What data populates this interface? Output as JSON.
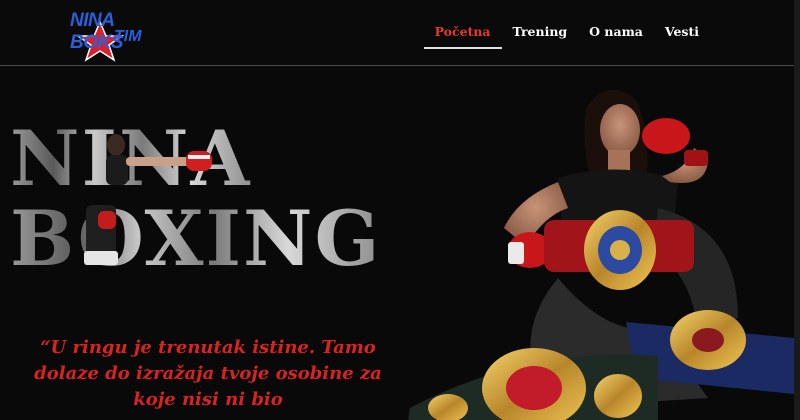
{
  "logo": {
    "line1": "NINA BOKS",
    "line2": "TIM"
  },
  "nav": {
    "items": [
      {
        "label": "Početna",
        "active": true
      },
      {
        "label": "Trening",
        "active": false
      },
      {
        "label": "O nama",
        "active": false
      },
      {
        "label": "Vesti",
        "active": false
      }
    ]
  },
  "hero": {
    "title_line1": "NINA",
    "title_line2": "BOXING",
    "quote": "“U ringu je trenutak istine. Tamo dolaze do izražaja tvoje osobine za koje nisi ni bio"
  },
  "colors": {
    "accent_red": "#e23b2b",
    "quote_red": "#d9231f",
    "logo_blue": "#2b5fd9",
    "background": "#0b0b0c"
  }
}
